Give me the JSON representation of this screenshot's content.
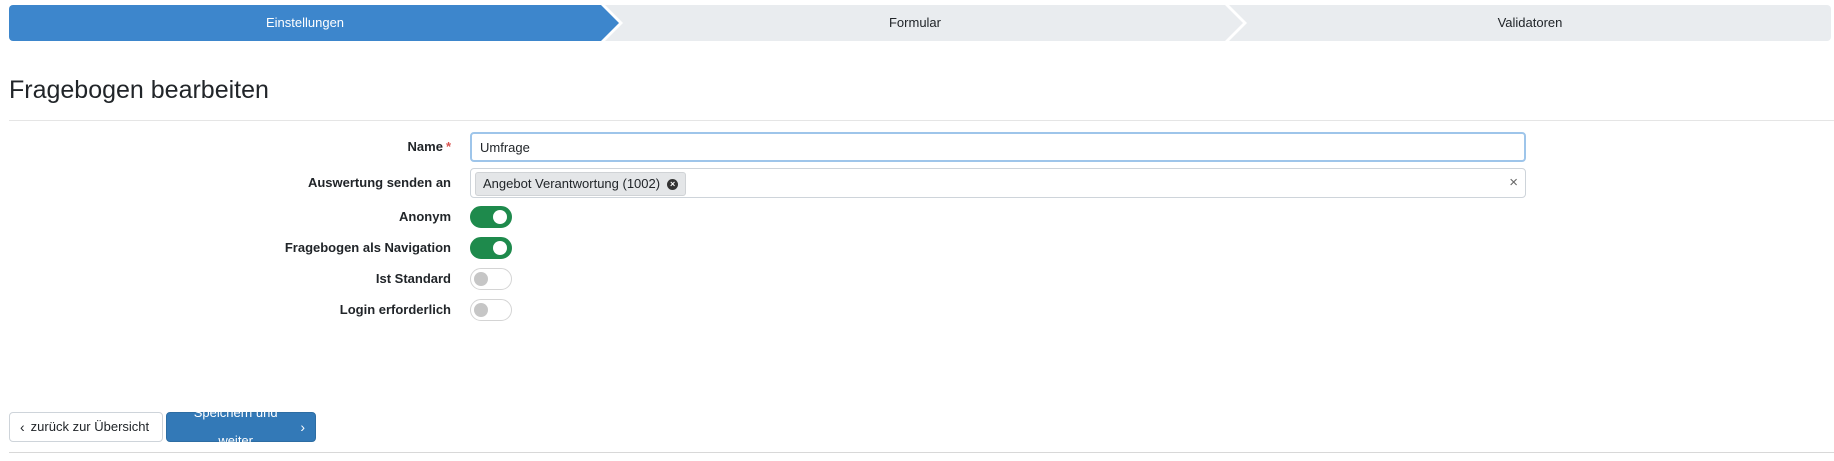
{
  "wizard": {
    "steps": [
      {
        "label": "Einstellungen",
        "active": true
      },
      {
        "label": "Formular",
        "active": false
      },
      {
        "label": "Validatoren",
        "active": false
      }
    ]
  },
  "page": {
    "title": "Fragebogen bearbeiten"
  },
  "form": {
    "name": {
      "label": "Name",
      "required_marker": "*",
      "value": "Umfrage"
    },
    "send_to": {
      "label": "Auswertung senden an",
      "tag": "Angebot Verantwortung (1002)",
      "clear_symbol": "×"
    },
    "anonym": {
      "label": "Anonym",
      "checked": true
    },
    "navigation": {
      "label": "Fragebogen als Navigation",
      "checked": true
    },
    "standard": {
      "label": "Ist Standard",
      "checked": false
    },
    "login": {
      "label": "Login erforderlich",
      "checked": false
    }
  },
  "actions": {
    "back_label": "zurück zur Übersicht",
    "save_label": "Speichern und weiter"
  },
  "colors": {
    "primary": "#3d86cc",
    "toggle_on": "#1e8a4c",
    "required": "#d9534f"
  }
}
